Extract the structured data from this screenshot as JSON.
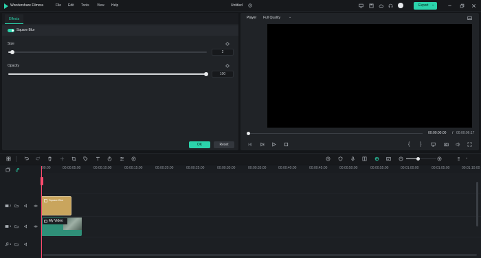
{
  "app": {
    "name": "Wondershare Filmora",
    "project_title": "Untitled"
  },
  "menu": [
    "File",
    "Edit",
    "Tools",
    "View",
    "Help"
  ],
  "export_label": "Export",
  "effects": {
    "tab": "Effects",
    "effect_name": "Square Blur",
    "size": {
      "label": "Size",
      "value": "2"
    },
    "opacity": {
      "label": "Opacity",
      "value": "100"
    },
    "ok": "OK",
    "reset": "Reset"
  },
  "player": {
    "label": "Player",
    "quality": "Full Quality",
    "current_time": "00:00:00:00",
    "separator": "/",
    "total_time": "00:00:06:17"
  },
  "timeline": {
    "ruler": [
      "00:00",
      "00:00:05:00",
      "00:00:10:00",
      "00:00:15:00",
      "00:00:20:00",
      "00:00:25:00",
      "00:00:30:00",
      "00:00:35:00",
      "00:00:40:00",
      "00:00:45:00",
      "00:00:50:00",
      "00:00:55:00",
      "00:01:00:00",
      "00:01:05:00",
      "00:01:10:00"
    ],
    "clips": {
      "effect": "Square Blur",
      "video": "My Video"
    },
    "tracks": [
      "2",
      "1",
      "1"
    ]
  },
  "colors": {
    "accent": "#2bd3ab",
    "playhead": "#ff4b6e",
    "effect_clip": "#c9a55d",
    "video_clip": "#2f8f78"
  }
}
